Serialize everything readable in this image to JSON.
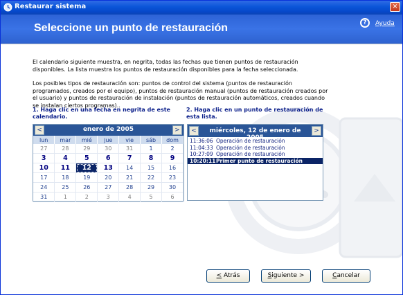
{
  "window": {
    "title": "Restaurar sistema"
  },
  "header": {
    "heading": "Seleccione un punto de restauración",
    "help_label": "Ayuda"
  },
  "intro": {
    "paragraph1": "El calendario siguiente muestra, en negrita, todas las fechas que tienen puntos de restauración disponibles. La lista muestra los puntos de restauración disponibles para la fecha seleccionada.",
    "paragraph2": "Los posibles tipos de restauración son: puntos de control del sistema (puntos de restauración programados, creados por el equipo), puntos de restauración manual (puntos de restauración creados por el usuario) y puntos de restauración de instalación (puntos de restauración automáticos, creados cuando se instalan ciertos programas).."
  },
  "steps": {
    "step1": "1. Haga clic en una fecha en negrita de este calendario.",
    "step2": "2. Haga clic en un punto de restauración de esta lista."
  },
  "calendar": {
    "prev_label": "<",
    "next_label": ">",
    "month_label": "enero de 2005",
    "weekdays": [
      "lun",
      "mar",
      "mié",
      "jue",
      "vie",
      "sáb",
      "dom"
    ],
    "weeks": [
      [
        {
          "d": "27",
          "o": true
        },
        {
          "d": "28",
          "o": true
        },
        {
          "d": "29",
          "o": true
        },
        {
          "d": "30",
          "o": true
        },
        {
          "d": "31",
          "o": true
        },
        {
          "d": "1"
        },
        {
          "d": "2"
        }
      ],
      [
        {
          "d": "3",
          "b": true
        },
        {
          "d": "4",
          "b": true
        },
        {
          "d": "5",
          "b": true
        },
        {
          "d": "6",
          "b": true
        },
        {
          "d": "7",
          "b": true
        },
        {
          "d": "8",
          "b": true
        },
        {
          "d": "9",
          "b": true
        }
      ],
      [
        {
          "d": "10",
          "b": true
        },
        {
          "d": "11",
          "b": true
        },
        {
          "d": "12",
          "s": true
        },
        {
          "d": "13",
          "b": true
        },
        {
          "d": "14"
        },
        {
          "d": "15"
        },
        {
          "d": "16"
        }
      ],
      [
        {
          "d": "17"
        },
        {
          "d": "18"
        },
        {
          "d": "19"
        },
        {
          "d": "20"
        },
        {
          "d": "21"
        },
        {
          "d": "22"
        },
        {
          "d": "23"
        }
      ],
      [
        {
          "d": "24"
        },
        {
          "d": "25"
        },
        {
          "d": "26"
        },
        {
          "d": "27"
        },
        {
          "d": "28"
        },
        {
          "d": "29"
        },
        {
          "d": "30"
        }
      ],
      [
        {
          "d": "31"
        },
        {
          "d": "1",
          "o": true
        },
        {
          "d": "2",
          "o": true
        },
        {
          "d": "3",
          "o": true
        },
        {
          "d": "4",
          "o": true
        },
        {
          "d": "5",
          "o": true
        },
        {
          "d": "6",
          "o": true
        }
      ]
    ]
  },
  "restore_list": {
    "prev_label": "<",
    "next_label": ">",
    "date_label": "miércoles, 12 de enero de 2005",
    "items": [
      {
        "time": "11:36:06",
        "description": "Operación de restauración",
        "selected": false
      },
      {
        "time": "11:04:33",
        "description": "Operación de restauración",
        "selected": false
      },
      {
        "time": "10:27:09",
        "description": "Operación de restauración",
        "selected": false
      },
      {
        "time": "10:20:11",
        "description": "Primer punto de restauración",
        "selected": true
      }
    ]
  },
  "buttons": {
    "back": {
      "mnemonic": "<",
      "rest": " Atrás"
    },
    "next": {
      "mnemonic": "S",
      "rest": "iguiente >"
    },
    "cancel": {
      "mnemonic": "C",
      "rest": "ancelar"
    }
  },
  "colors": {
    "title_bar": "#0a55d8",
    "header_band": "#3a73e6",
    "calendar_header": "#2a5597",
    "selection": "#0b2466"
  }
}
